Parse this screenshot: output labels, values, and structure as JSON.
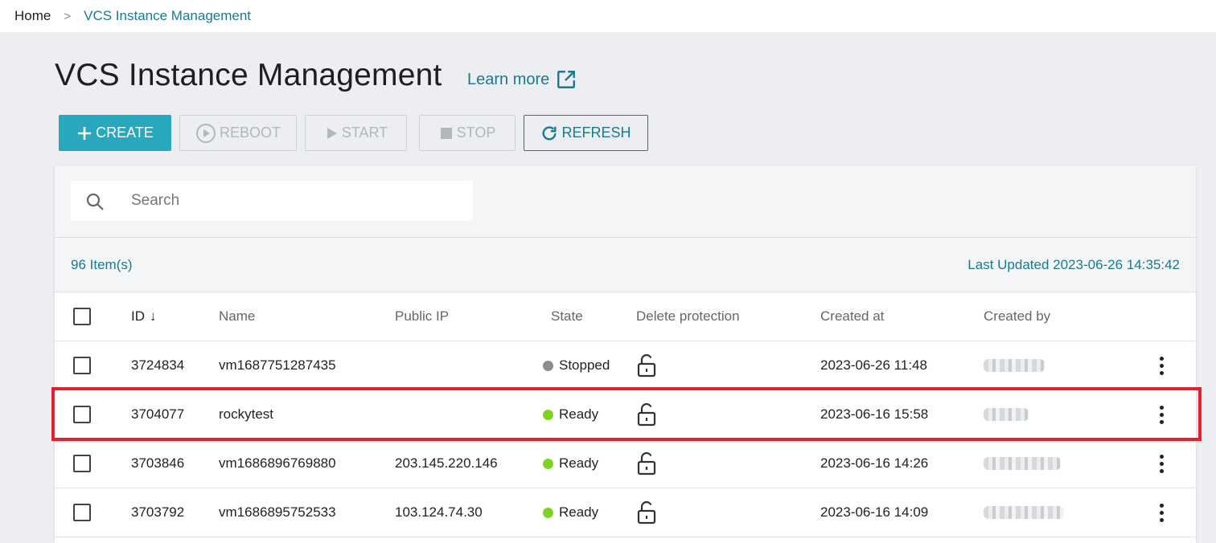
{
  "breadcrumb": {
    "home": "Home",
    "separator": ">",
    "current": "VCS Instance Management"
  },
  "page": {
    "title": "VCS Instance Management",
    "learn_more": "Learn more"
  },
  "toolbar": {
    "create": "CREATE",
    "reboot": "REBOOT",
    "start": "START",
    "stop": "STOP",
    "refresh": "REFRESH"
  },
  "search": {
    "placeholder": "Search",
    "value": ""
  },
  "summary": {
    "count": "96 Item(s)",
    "last_updated": "Last Updated 2023-06-26 14:35:42"
  },
  "table": {
    "columns": {
      "id": "ID",
      "name": "Name",
      "public_ip": "Public IP",
      "state": "State",
      "delete_protection": "Delete protection",
      "created_at": "Created at",
      "created_by": "Created by"
    },
    "sort_indicator": "↓",
    "rows": [
      {
        "id": "3724834",
        "name": "vm1687751287435",
        "public_ip": "",
        "state": "Stopped",
        "state_color": "#8c8c8c",
        "created_at": "2023-06-26 11:48"
      },
      {
        "id": "3704077",
        "name": "rockytest",
        "public_ip": "",
        "state": "Ready",
        "state_color": "#7ed321",
        "created_at": "2023-06-16 15:58"
      },
      {
        "id": "3703846",
        "name": "vm1686896769880",
        "public_ip": "203.145.220.146",
        "state": "Ready",
        "state_color": "#7ed321",
        "created_at": "2023-06-16 14:26"
      },
      {
        "id": "3703792",
        "name": "vm1686895752533",
        "public_ip": "103.124.74.30",
        "state": "Ready",
        "state_color": "#7ed321",
        "created_at": "2023-06-16 14:09"
      }
    ]
  },
  "colors": {
    "accent": "#28a8bd",
    "link": "#1a7a8c",
    "highlight": "#e4202d"
  }
}
